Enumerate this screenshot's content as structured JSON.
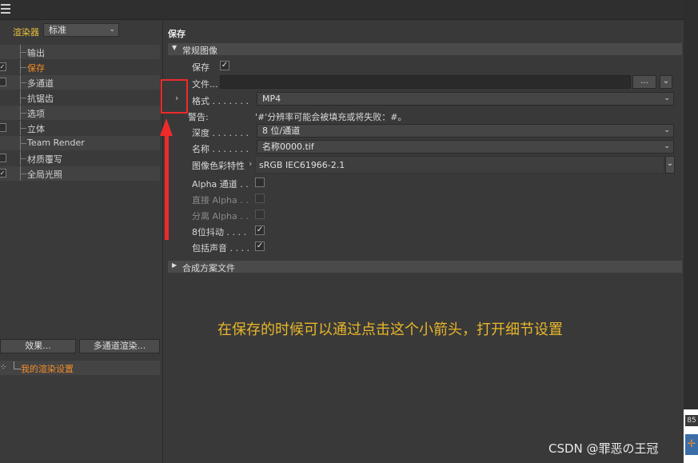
{
  "left": {
    "renderer_label": "渲染器",
    "renderer_value": "标准",
    "tree": [
      {
        "label": "输出",
        "checkbox": false,
        "checked": false,
        "active": false
      },
      {
        "label": "保存",
        "checkbox": true,
        "checked": true,
        "active": true
      },
      {
        "label": "多通道",
        "checkbox": true,
        "checked": false,
        "active": false
      },
      {
        "label": "抗锯齿",
        "checkbox": false,
        "checked": false,
        "active": false
      },
      {
        "label": "选项",
        "checkbox": false,
        "checked": false,
        "active": false
      },
      {
        "label": "立体",
        "checkbox": true,
        "checked": false,
        "active": false
      },
      {
        "label": "Team Render",
        "checkbox": false,
        "checked": false,
        "active": false
      },
      {
        "label": "材质覆写",
        "checkbox": true,
        "checked": false,
        "active": false
      },
      {
        "label": "全局光照",
        "checkbox": true,
        "checked": true,
        "active": false
      }
    ],
    "effects_button": "效果...",
    "multipass_button": "多通道渲染...",
    "my_settings": "我的渲染设置"
  },
  "right": {
    "section_title": "保存",
    "regular_group": "常规图像",
    "save_label": "保存",
    "save_checked": true,
    "file_label": "文件...",
    "file_value": "",
    "browse_button": "...",
    "format_label": "格式 . . . . . . .",
    "format_value": "MP4",
    "warning_label": "警告:",
    "warning_text": "'#'分辨率可能会被填充或将失败：#。",
    "depth_label": "深度 . . . . . . .",
    "depth_value": "8 位/通道",
    "name_label": "名称 . . . . . . .",
    "name_value": "名称0000.tif",
    "color_profile_label": "图像色彩特性",
    "color_profile_value": "sRGB IEC61966-2.1",
    "alpha_label": "Alpha 通道 . .",
    "alpha_checked": false,
    "straight_alpha_label": "直接 Alpha . .",
    "separate_alpha_label": "分离 Alpha . .",
    "dither_label": "8位抖动 . . . .",
    "dither_checked": true,
    "sound_label": "包括声音 . . . .",
    "sound_checked": true,
    "compositing_group": "合成方案文件"
  },
  "annotation_text": "在保存的时候可以通过点击这个小箭头，打开细节设置",
  "annotation_color": "#e8b62a",
  "highlight_color": "#ef2a2a",
  "accent_color": "#f28c28",
  "side_number": "85",
  "watermark": "CSDN @罪恶の王冠"
}
